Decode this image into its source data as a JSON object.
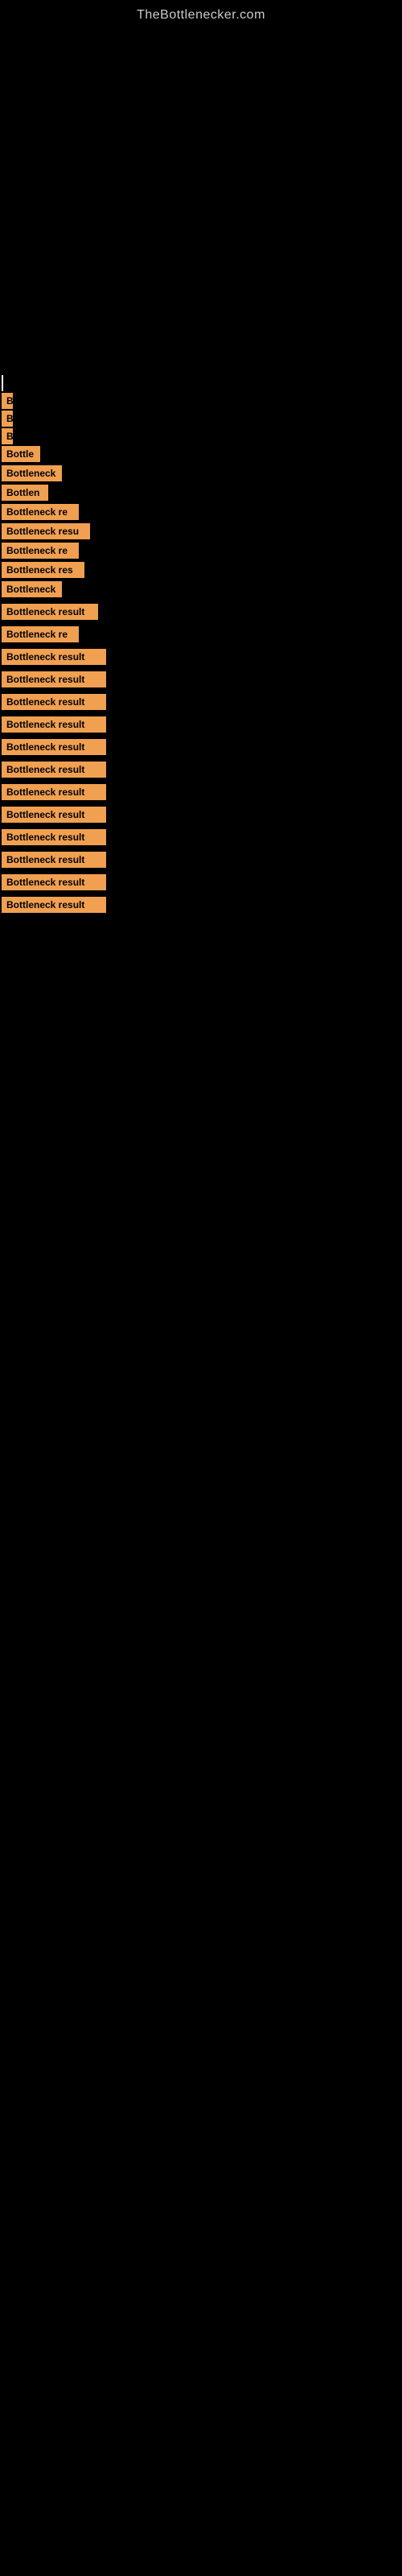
{
  "site": {
    "title": "TheBottlenecker.com"
  },
  "items": [
    {
      "id": 1,
      "label": "B",
      "width": 14,
      "gap_after": 2
    },
    {
      "id": 2,
      "label": "B",
      "width": 14,
      "gap_after": 2
    },
    {
      "id": 3,
      "label": "B",
      "width": 14,
      "gap_after": 2
    },
    {
      "id": 4,
      "label": "Bottle",
      "width": 48,
      "gap_after": 4
    },
    {
      "id": 5,
      "label": "Bottleneck",
      "width": 75,
      "gap_after": 4
    },
    {
      "id": 6,
      "label": "Bottlen",
      "width": 58,
      "gap_after": 4
    },
    {
      "id": 7,
      "label": "Bottleneck re",
      "width": 96,
      "gap_after": 4
    },
    {
      "id": 8,
      "label": "Bottleneck resu",
      "width": 110,
      "gap_after": 4
    },
    {
      "id": 9,
      "label": "Bottleneck re",
      "width": 96,
      "gap_after": 4
    },
    {
      "id": 10,
      "label": "Bottleneck res",
      "width": 103,
      "gap_after": 4
    },
    {
      "id": 11,
      "label": "Bottleneck",
      "width": 75,
      "gap_after": 8
    },
    {
      "id": 12,
      "label": "Bottleneck result",
      "width": 120,
      "gap_after": 8
    },
    {
      "id": 13,
      "label": "Bottleneck re",
      "width": 96,
      "gap_after": 8
    },
    {
      "id": 14,
      "label": "Bottleneck result",
      "width": 130,
      "gap_after": 8
    },
    {
      "id": 15,
      "label": "Bottleneck result",
      "width": 130,
      "gap_after": 8
    },
    {
      "id": 16,
      "label": "Bottleneck result",
      "width": 130,
      "gap_after": 8
    },
    {
      "id": 17,
      "label": "Bottleneck result",
      "width": 130,
      "gap_after": 8
    },
    {
      "id": 18,
      "label": "Bottleneck result",
      "width": 130,
      "gap_after": 8
    },
    {
      "id": 19,
      "label": "Bottleneck result",
      "width": 130,
      "gap_after": 8
    },
    {
      "id": 20,
      "label": "Bottleneck result",
      "width": 130,
      "gap_after": 8
    },
    {
      "id": 21,
      "label": "Bottleneck result",
      "width": 130,
      "gap_after": 8
    },
    {
      "id": 22,
      "label": "Bottleneck result",
      "width": 130,
      "gap_after": 8
    },
    {
      "id": 23,
      "label": "Bottleneck result",
      "width": 130,
      "gap_after": 8
    },
    {
      "id": 24,
      "label": "Bottleneck result",
      "width": 130,
      "gap_after": 8
    },
    {
      "id": 25,
      "label": "Bottleneck result",
      "width": 130,
      "gap_after": 8
    }
  ]
}
